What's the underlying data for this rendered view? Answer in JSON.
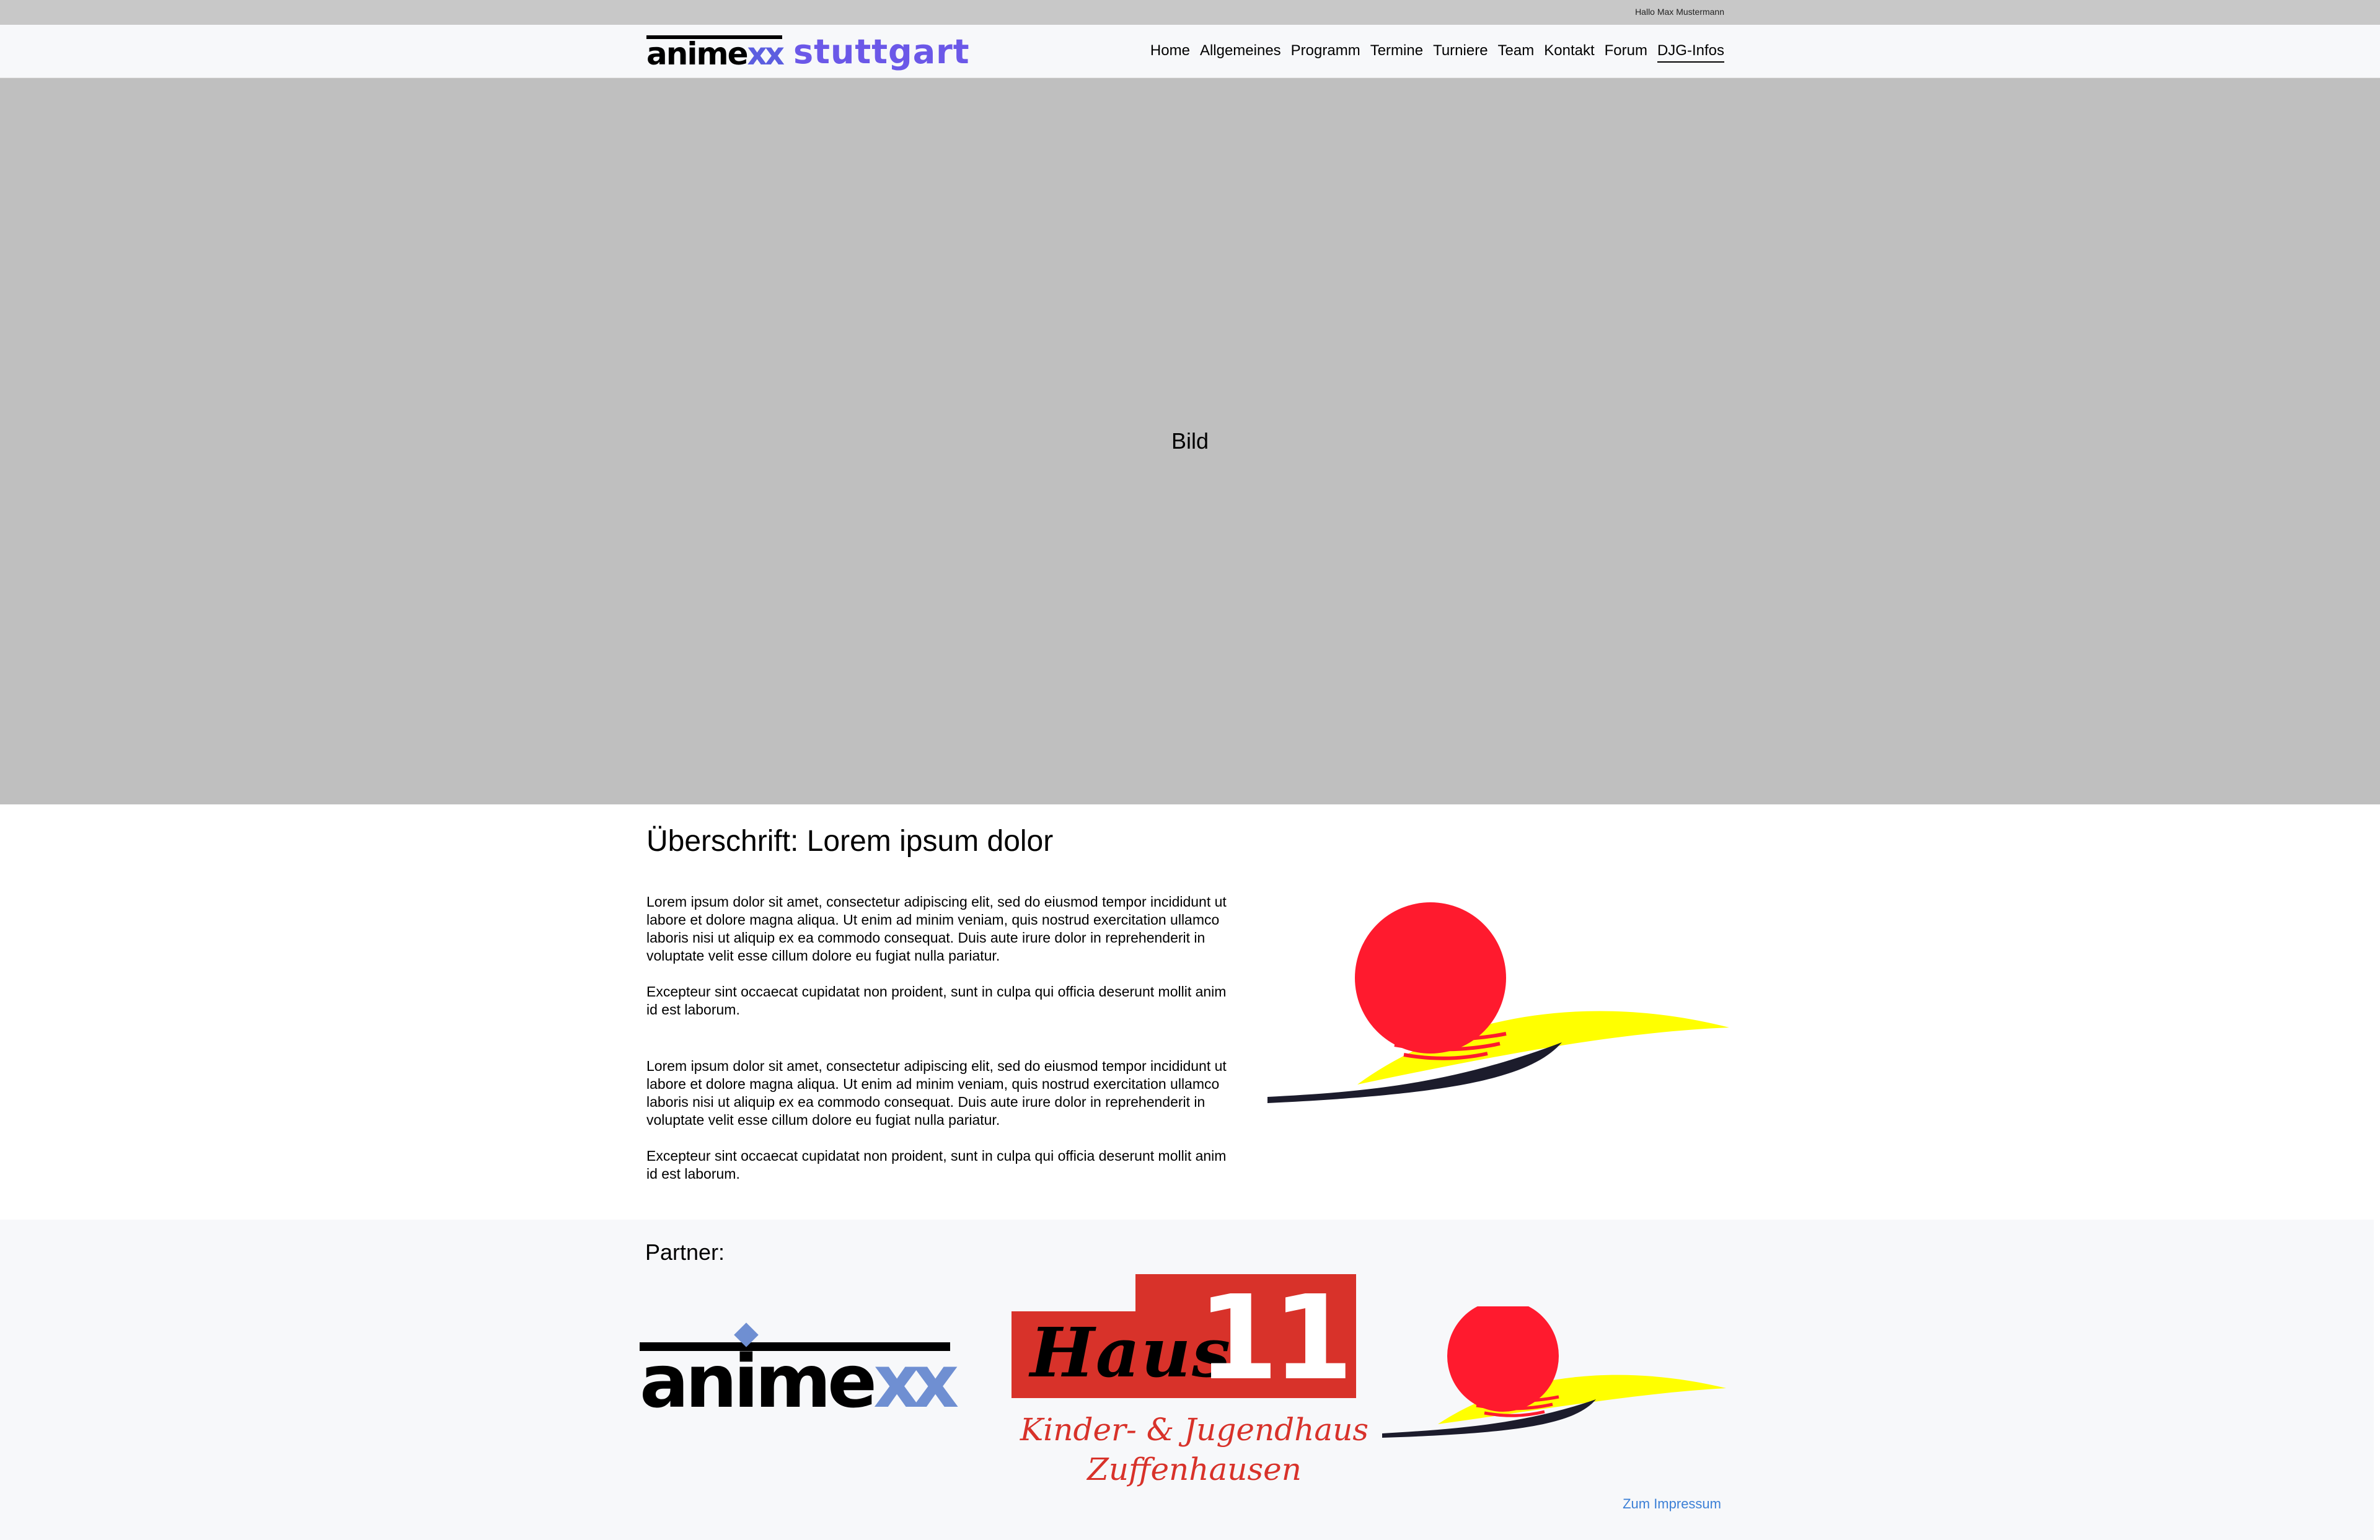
{
  "topbar": {
    "greeting": "Hallo Max Mustermann"
  },
  "header": {
    "logo_brand_main": "anime",
    "logo_brand_xx": "xx",
    "logo_city": "stuttgart",
    "nav": [
      {
        "label": "Home"
      },
      {
        "label": "Allgemeines"
      },
      {
        "label": "Programm"
      },
      {
        "label": "Termine"
      },
      {
        "label": "Turniere"
      },
      {
        "label": "Team"
      },
      {
        "label": "Kontakt"
      },
      {
        "label": "Forum"
      },
      {
        "label": "DJG-Infos",
        "active": true
      }
    ]
  },
  "hero": {
    "placeholder": "Bild"
  },
  "content": {
    "heading": "Überschrift: Lorem ipsum dolor",
    "paragraphs": [
      "Lorem ipsum dolor sit amet, consectetur adipiscing elit, sed do eiusmod tempor incididunt ut labore et dolore magna aliqua. Ut enim ad minim veniam, quis nostrud exercitation ullamco laboris nisi ut aliquip ex ea commodo consequat. Duis aute irure dolor in reprehenderit in voluptate velit esse cillum dolore eu fugiat nulla pariatur.",
      "Excepteur sint occaecat cupidatat non proident, sunt in culpa qui officia deserunt mollit anim id est laborum.",
      "Lorem ipsum dolor sit amet, consectetur adipiscing elit, sed do eiusmod tempor incididunt ut labore et dolore magna aliqua. Ut enim ad minim veniam, quis nostrud exercitation ullamco laboris nisi ut aliquip ex ea commodo consequat. Duis aute irure dolor in reprehenderit in voluptate velit esse cillum dolore eu fugiat nulla pariatur.",
      "Excepteur sint occaecat cupidatat non proident, sunt in culpa qui officia deserunt mollit anim id est laborum."
    ]
  },
  "footer": {
    "partner_title": "Partner:",
    "partner_animexx_main": "anime",
    "partner_animexx_xx": "xx",
    "haus_word": "Haus",
    "haus_number": "11",
    "haus_line1": "Kinder- & Jugendhaus",
    "haus_line2": "Zuffenhausen",
    "impressum_link": "Zum Impressum"
  },
  "colors": {
    "topbar": "#c8c8c8",
    "header_bg": "#f7f8fa",
    "hero_bg": "#bfbfbf",
    "brand_purple": "#6b58e8",
    "animexx_blue": "#6f8fd2",
    "haus_red": "#d8322a",
    "sun_red": "#ff1a2e",
    "sun_yellow": "#ffff00",
    "link_blue": "#3b7fd6"
  }
}
